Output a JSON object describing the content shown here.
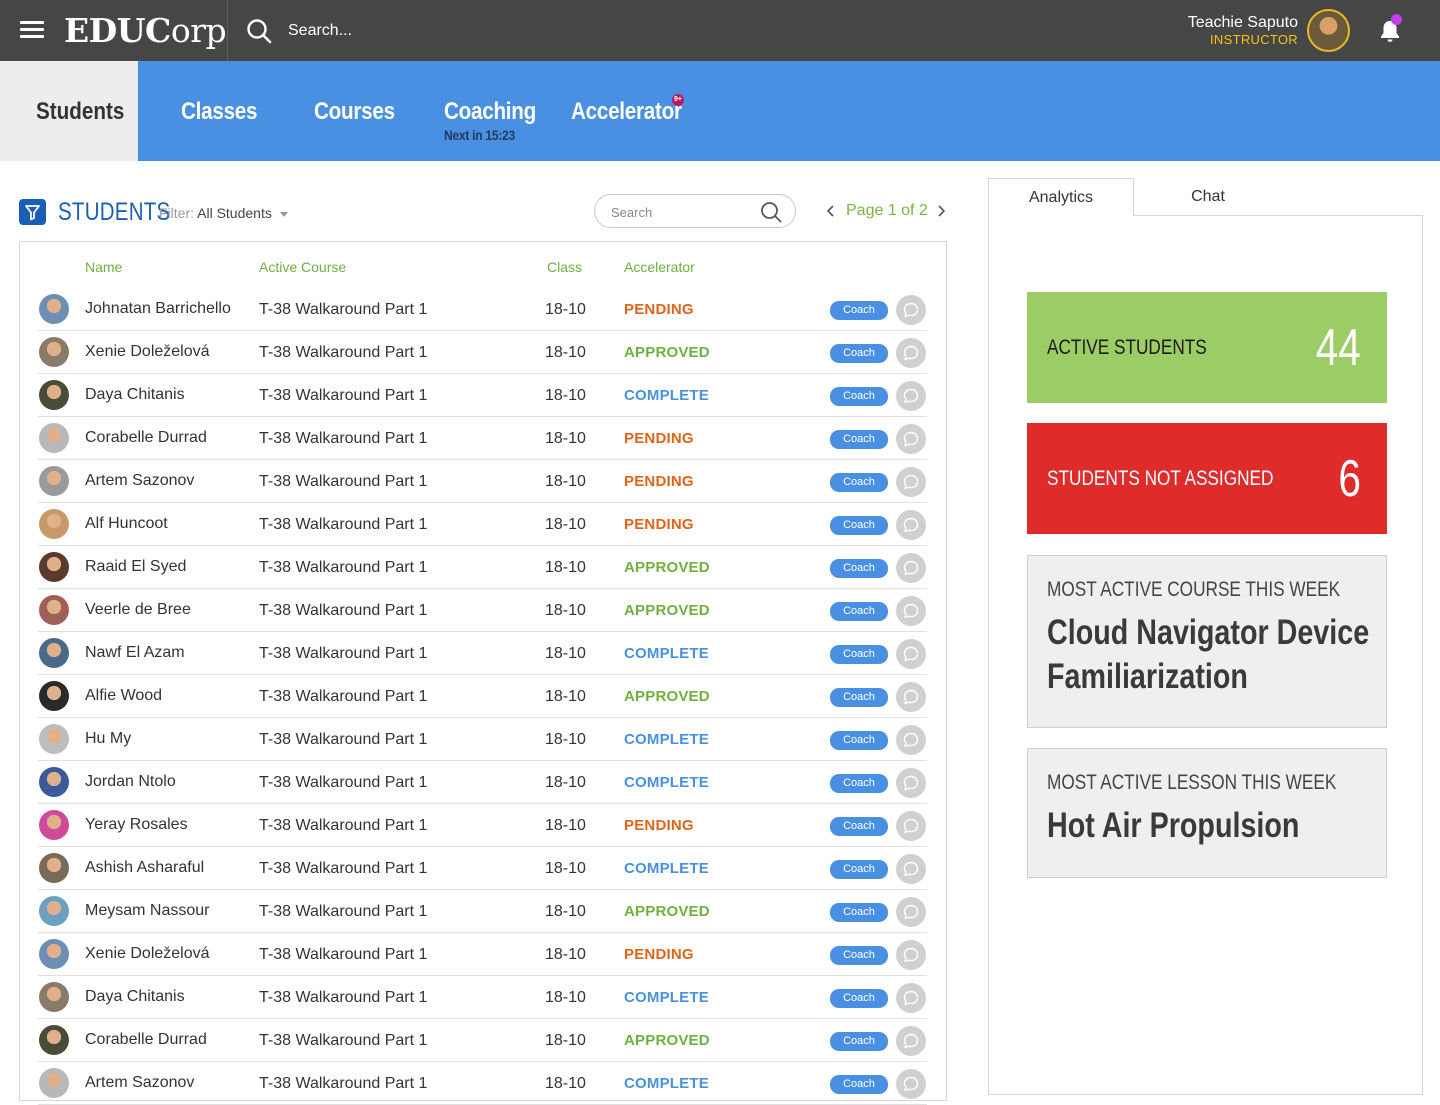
{
  "header": {
    "logo_bold": "EDUC",
    "logo_light": "orp",
    "search_placeholder": "Search...",
    "user_name": "Teachie Saputo",
    "user_role": "INSTRUCTOR"
  },
  "nav": {
    "tabs": [
      {
        "label": "Students"
      },
      {
        "label": "Classes"
      },
      {
        "label": "Courses"
      },
      {
        "label": "Coaching",
        "sub": "Next in 15:23"
      },
      {
        "label": "Accelerator",
        "badge": "9+"
      }
    ]
  },
  "students": {
    "title": "STUDENTS",
    "filter_label": "Filter:",
    "filter_value": "All Students",
    "search_placeholder": "Search",
    "pager": "Page 1 of 2",
    "columns": [
      "Name",
      "Active Course",
      "Class",
      "Accelerator"
    ],
    "coach_label": "Coach",
    "status_colors": {
      "PENDING": "#e0631a",
      "APPROVED": "#6fb03e",
      "COMPLETE": "#4a90e2"
    },
    "rows": [
      {
        "name": "Johnatan Barrichello",
        "course": "T-38 Walkaround Part 1",
        "class": "18-10",
        "status": "PENDING"
      },
      {
        "name": "Xenie Doleželová",
        "course": "T-38 Walkaround Part 1",
        "class": "18-10",
        "status": "APPROVED"
      },
      {
        "name": "Daya Chitanis",
        "course": "T-38 Walkaround Part 1",
        "class": "18-10",
        "status": "COMPLETE"
      },
      {
        "name": "Corabelle Durrad",
        "course": "T-38 Walkaround Part 1",
        "class": "18-10",
        "status": "PENDING"
      },
      {
        "name": "Artem Sazonov",
        "course": "T-38 Walkaround Part 1",
        "class": "18-10",
        "status": "PENDING"
      },
      {
        "name": "Alf Huncoot",
        "course": "T-38 Walkaround Part 1",
        "class": "18-10",
        "status": "PENDING"
      },
      {
        "name": "Raaid El Syed",
        "course": "T-38 Walkaround Part 1",
        "class": "18-10",
        "status": "APPROVED"
      },
      {
        "name": "Veerle de Bree",
        "course": "T-38 Walkaround Part 1",
        "class": "18-10",
        "status": "APPROVED"
      },
      {
        "name": "Nawf El Azam",
        "course": "T-38 Walkaround Part 1",
        "class": "18-10",
        "status": "COMPLETE"
      },
      {
        "name": "Alfie Wood",
        "course": "T-38 Walkaround Part 1",
        "class": "18-10",
        "status": "APPROVED"
      },
      {
        "name": "Hu My",
        "course": "T-38 Walkaround Part 1",
        "class": "18-10",
        "status": "COMPLETE"
      },
      {
        "name": "Jordan Ntolo",
        "course": "T-38 Walkaround Part 1",
        "class": "18-10",
        "status": "COMPLETE"
      },
      {
        "name": "Yeray Rosales",
        "course": "T-38 Walkaround Part 1",
        "class": "18-10",
        "status": "PENDING"
      },
      {
        "name": "Ashish Asharaful",
        "course": "T-38 Walkaround Part 1",
        "class": "18-10",
        "status": "COMPLETE"
      },
      {
        "name": "Meysam Nassour",
        "course": "T-38 Walkaround Part 1",
        "class": "18-10",
        "status": "APPROVED"
      },
      {
        "name": "Xenie Doleželová",
        "course": "T-38 Walkaround Part 1",
        "class": "18-10",
        "status": "PENDING"
      },
      {
        "name": "Daya Chitanis",
        "course": "T-38 Walkaround Part 1",
        "class": "18-10",
        "status": "COMPLETE"
      },
      {
        "name": "Corabelle Durrad",
        "course": "T-38 Walkaround Part 1",
        "class": "18-10",
        "status": "APPROVED"
      },
      {
        "name": "Artem Sazonov",
        "course": "T-38 Walkaround Part 1",
        "class": "18-10",
        "status": "COMPLETE"
      }
    ]
  },
  "right_panel": {
    "tabs": [
      "Analytics",
      "Chat"
    ],
    "active_students_label": "ACTIVE STUDENTS",
    "active_students_value": "44",
    "not_assigned_label": "STUDENTS NOT ASSIGNED",
    "not_assigned_value": "6",
    "course_caption": "MOST ACTIVE COURSE THIS WEEK",
    "course_title": "Cloud Navigator Device Familiarization",
    "lesson_caption": "MOST ACTIVE LESSON THIS WEEK",
    "lesson_title": "Hot Air Propulsion"
  },
  "colors": {
    "topbar": "#464646",
    "nav": "#4a90e2",
    "accent_green": "#9ccc65",
    "accent_red": "#e02b2b",
    "role_yellow": "#f2c21b"
  }
}
